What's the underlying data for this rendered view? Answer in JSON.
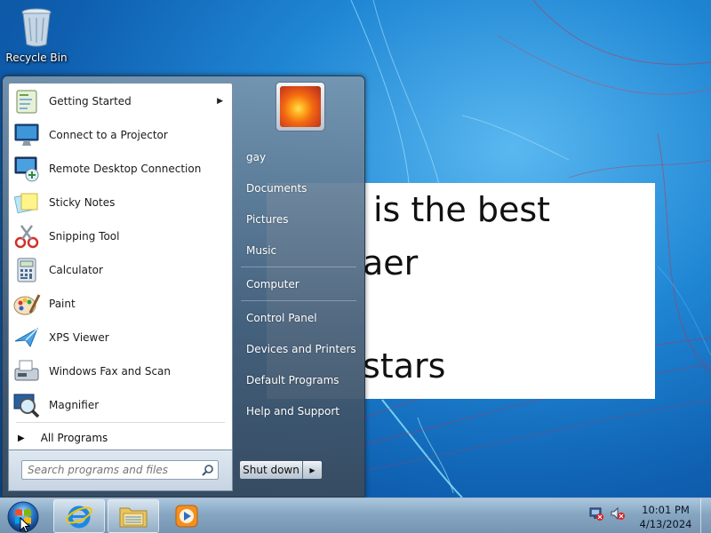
{
  "desktop": {
    "recycle_bin_label": "Recycle Bin"
  },
  "document": {
    "lines": [
      "is the best",
      "aer",
      "stars"
    ]
  },
  "start_menu": {
    "programs": [
      {
        "label": "Getting Started",
        "icon": "getting-started-icon",
        "has_submenu": true
      },
      {
        "label": "Connect to a Projector",
        "icon": "projector-icon"
      },
      {
        "label": "Remote Desktop Connection",
        "icon": "remote-desktop-icon"
      },
      {
        "label": "Sticky Notes",
        "icon": "sticky-notes-icon"
      },
      {
        "label": "Snipping Tool",
        "icon": "snipping-tool-icon"
      },
      {
        "label": "Calculator",
        "icon": "calculator-icon"
      },
      {
        "label": "Paint",
        "icon": "paint-icon"
      },
      {
        "label": "XPS Viewer",
        "icon": "xps-viewer-icon"
      },
      {
        "label": "Windows Fax and Scan",
        "icon": "fax-scan-icon"
      },
      {
        "label": "Magnifier",
        "icon": "magnifier-icon"
      }
    ],
    "all_programs_label": "All Programs",
    "search_placeholder": "Search programs and files",
    "right_items": [
      "gay",
      "Documents",
      "Pictures",
      "Music",
      "Computer",
      "Control Panel",
      "Devices and Printers",
      "Default Programs",
      "Help and Support"
    ],
    "shutdown_label": "Shut down"
  },
  "taskbar": {
    "pinned": [
      "start-orb-icon",
      "internet-explorer-icon",
      "file-explorer-icon",
      "media-player-icon"
    ],
    "clock_time": "10:01 PM",
    "clock_date": "4/13/2024"
  },
  "colors": {
    "wallpaper_blue": "#1f86d4",
    "taskbar_glass": "#8caac3",
    "start_menu_glass": "#465f78"
  }
}
